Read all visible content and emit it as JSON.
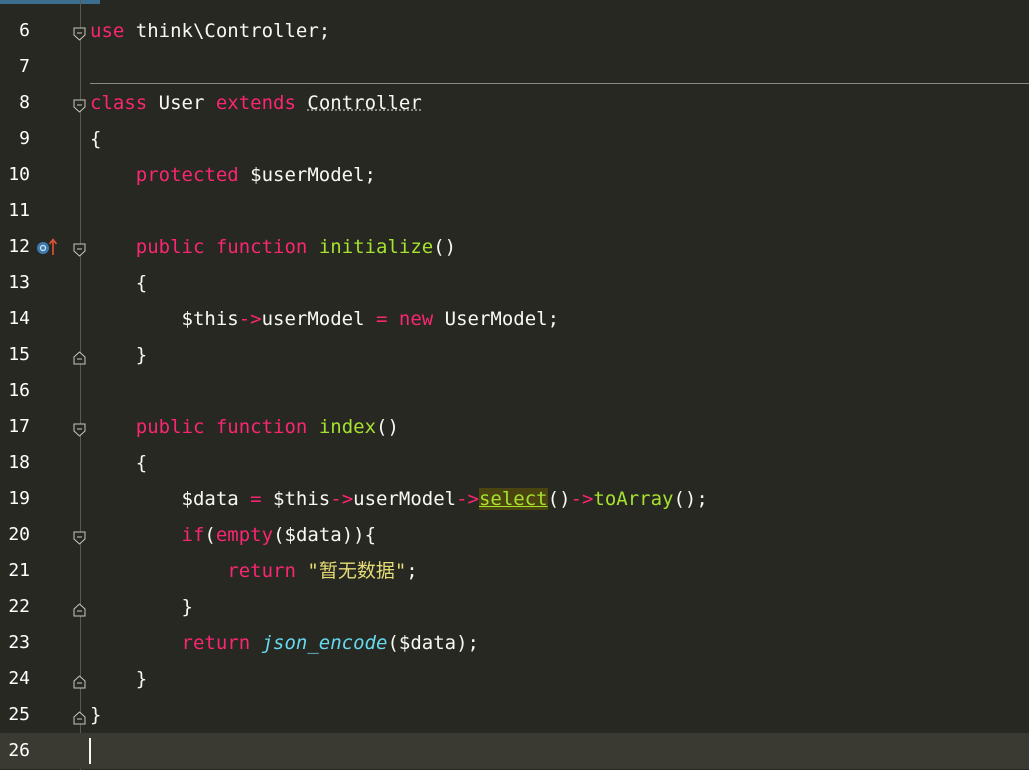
{
  "lines": [
    {
      "n": "6",
      "tokens": [
        [
          "kw",
          "use"
        ],
        [
          "pl",
          " think\\Controller;"
        ]
      ]
    },
    {
      "n": "7",
      "tokens": []
    },
    {
      "n": "8",
      "tokens": [
        [
          "kw",
          "class"
        ],
        [
          "pl",
          " User "
        ],
        [
          "kw",
          "extends"
        ],
        [
          "pl",
          " "
        ],
        [
          "u",
          "Controller"
        ]
      ]
    },
    {
      "n": "9",
      "tokens": [
        [
          "pl",
          "{"
        ]
      ]
    },
    {
      "n": "10",
      "tokens": [
        [
          "pl",
          "    "
        ],
        [
          "kw",
          "protected"
        ],
        [
          "pl",
          " $userModel;"
        ]
      ]
    },
    {
      "n": "11",
      "tokens": []
    },
    {
      "n": "12",
      "tokens": [
        [
          "pl",
          "    "
        ],
        [
          "kw",
          "public"
        ],
        [
          "pl",
          " "
        ],
        [
          "kw",
          "function"
        ],
        [
          "pl",
          " "
        ],
        [
          "fn",
          "initialize"
        ],
        [
          "pl",
          "()"
        ]
      ]
    },
    {
      "n": "13",
      "tokens": [
        [
          "pl",
          "    {"
        ]
      ]
    },
    {
      "n": "14",
      "tokens": [
        [
          "pl",
          "        $this"
        ],
        [
          "kw",
          "->"
        ],
        [
          "pl",
          "userModel "
        ],
        [
          "kw",
          "="
        ],
        [
          "pl",
          " "
        ],
        [
          "kw",
          "new"
        ],
        [
          "pl",
          " UserModel;"
        ]
      ]
    },
    {
      "n": "15",
      "tokens": [
        [
          "pl",
          "    }"
        ]
      ]
    },
    {
      "n": "16",
      "tokens": []
    },
    {
      "n": "17",
      "tokens": [
        [
          "pl",
          "    "
        ],
        [
          "kw",
          "public"
        ],
        [
          "pl",
          " "
        ],
        [
          "kw",
          "function"
        ],
        [
          "pl",
          " "
        ],
        [
          "fn",
          "index"
        ],
        [
          "pl",
          "()"
        ]
      ]
    },
    {
      "n": "18",
      "tokens": [
        [
          "pl",
          "    {"
        ]
      ]
    },
    {
      "n": "19",
      "tokens": [
        [
          "pl",
          "        $data "
        ],
        [
          "kw",
          "="
        ],
        [
          "pl",
          " $this"
        ],
        [
          "kw",
          "->"
        ],
        [
          "pl",
          "userModel"
        ],
        [
          "kw",
          "->"
        ],
        [
          "hl",
          "select"
        ],
        [
          "pl",
          "()"
        ],
        [
          "kw",
          "->"
        ],
        [
          "fn",
          "toArray"
        ],
        [
          "pl",
          "();"
        ]
      ]
    },
    {
      "n": "20",
      "tokens": [
        [
          "pl",
          "        "
        ],
        [
          "kw",
          "if"
        ],
        [
          "pl",
          "("
        ],
        [
          "kw",
          "empty"
        ],
        [
          "pl",
          "($data)){"
        ]
      ]
    },
    {
      "n": "21",
      "tokens": [
        [
          "pl",
          "            "
        ],
        [
          "kw",
          "return"
        ],
        [
          "pl",
          " "
        ],
        [
          "str",
          "\"暂无数据\""
        ],
        [
          "pl",
          ";"
        ]
      ]
    },
    {
      "n": "22",
      "tokens": [
        [
          "pl",
          "        }"
        ]
      ]
    },
    {
      "n": "23",
      "tokens": [
        [
          "pl",
          "        "
        ],
        [
          "kw",
          "return"
        ],
        [
          "pl",
          " "
        ],
        [
          "bi",
          "json_encode"
        ],
        [
          "pl",
          "($data);"
        ]
      ]
    },
    {
      "n": "24",
      "tokens": [
        [
          "pl",
          "    }"
        ]
      ]
    },
    {
      "n": "25",
      "tokens": [
        [
          "pl",
          "}"
        ]
      ]
    },
    {
      "n": "26",
      "tokens": []
    }
  ],
  "colors": {
    "background": "#272822",
    "keyword": "#f92672",
    "function": "#a6e22e",
    "builtin": "#66d9ef",
    "string": "#e6db74",
    "plain": "#f8f8f2"
  },
  "fold_open_lines": [
    "6",
    "8",
    "12",
    "17",
    "20"
  ],
  "fold_close_lines": [
    "15",
    "22",
    "24",
    "25"
  ],
  "override_marker_line": "12",
  "current_line": "26"
}
